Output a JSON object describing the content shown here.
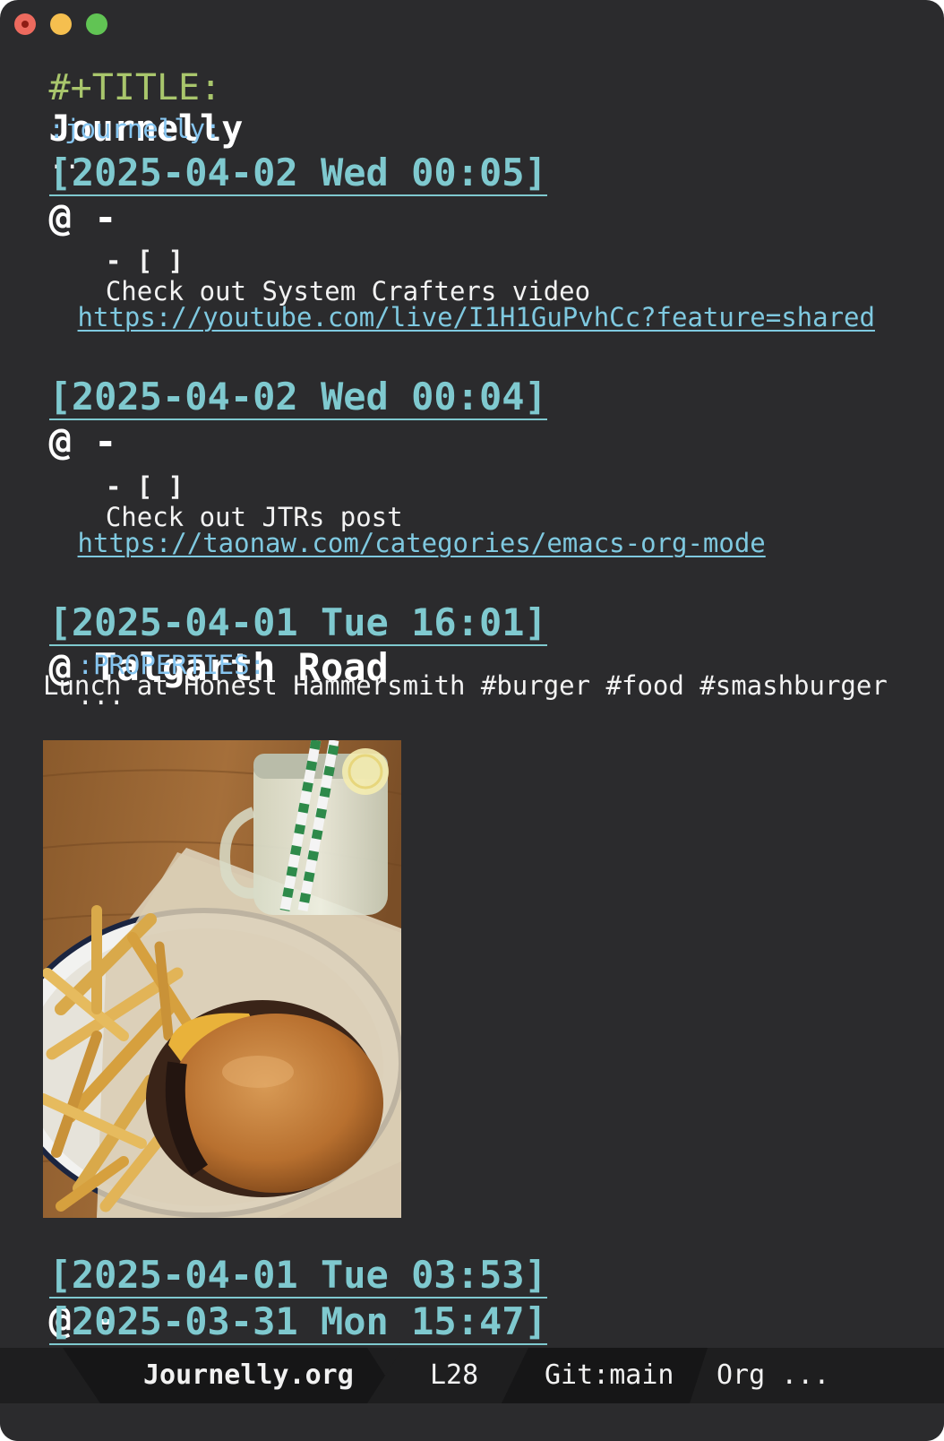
{
  "header": {
    "title_key": "#+TITLE:",
    "title_value": "Journelly",
    "drawer": ":journelly:",
    "drawer_ellipsis": "..."
  },
  "entries": [
    {
      "timestamp": "[2025-04-02 Wed 00:05]",
      "at": "@ -",
      "task_prefix": "- [ ]",
      "task_text": "Check out System Crafters video",
      "link": "https://youtube.com/live/I1H1GuPvhCc?feature=shared"
    },
    {
      "timestamp": "[2025-04-02 Wed 00:04]",
      "at": "@ -",
      "task_prefix": "- [ ]",
      "task_text": "Check out JTRs post",
      "link": "https://taonaw.com/categories/emacs-org-mode"
    },
    {
      "timestamp": "[2025-04-01 Tue 16:01]",
      "at": "@ Talgarth Road",
      "properties": ":PROPERTIES:",
      "properties_ellipsis": "...",
      "body": "Lunch at Honest Hammersmith #burger #food #smashburger"
    },
    {
      "timestamp": "[2025-04-01 Tue 03:53]",
      "at": "@ -",
      "ellipsis": "..."
    },
    {
      "timestamp": "[2025-03-31 Mon 15:47]",
      "at": "@ -",
      "ellipsis": "..."
    }
  ],
  "modeline": {
    "filename": "Journelly.org",
    "line": "L28",
    "git": "Git:main",
    "mode": "Org ..."
  },
  "colors": {
    "background": "#2b2b2d",
    "timestamp": "#7fc9cf",
    "link": "#7fc9e0",
    "drawer": "#86c5f0",
    "title_key": "#a9c66c",
    "modeline": "#1e1e1f"
  }
}
